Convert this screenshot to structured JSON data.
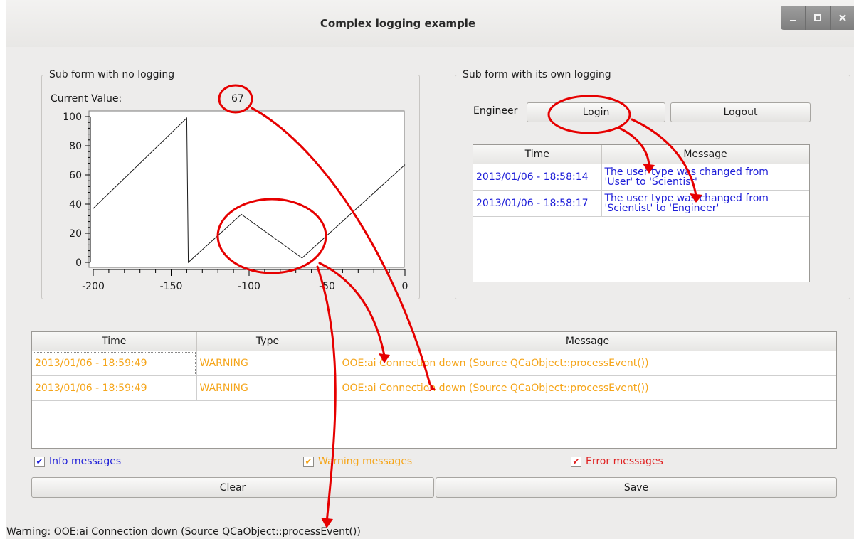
{
  "window": {
    "title": "Complex logging example"
  },
  "left_group": {
    "title": "Sub form with no logging",
    "current_value_label": "Current Value:",
    "current_value": "67"
  },
  "chart_data": {
    "type": "line",
    "x": [
      -200,
      -140,
      -139,
      -105,
      -66,
      0
    ],
    "series": [
      {
        "values": [
          37,
          99,
          0,
          33,
          3,
          67
        ]
      }
    ],
    "xlim": [
      -200,
      0
    ],
    "ylim": [
      0,
      100
    ],
    "xticks": [
      "-200",
      "-150",
      "-100",
      "-50",
      "0"
    ],
    "yticks": [
      "0",
      "20",
      "40",
      "60",
      "80",
      "100"
    ],
    "grid": false
  },
  "right_group": {
    "title": "Sub form with its own logging",
    "user_label": "Engineer",
    "login_label": "Login",
    "logout_label": "Logout",
    "columns": [
      "Time",
      "Message"
    ],
    "rows": [
      {
        "time": "2013/01/06 - 18:58:14",
        "message1": "The user type was changed from",
        "message2": "'User' to 'Scientist'"
      },
      {
        "time": "2013/01/06 - 18:58:17",
        "message1": "The user type was changed from",
        "message2": "'Scientist' to 'Engineer'"
      }
    ]
  },
  "main_log": {
    "columns": [
      "Time",
      "Type",
      "Message"
    ],
    "rows": [
      {
        "time": "2013/01/06 - 18:59:49",
        "type": "WARNING",
        "message": "OOE:ai Connection down (Source QCaObject::processEvent())"
      },
      {
        "time": "2013/01/06 - 18:59:49",
        "type": "WARNING",
        "message": "OOE:ai Connection down (Source QCaObject::processEvent())"
      }
    ]
  },
  "filters": {
    "info": "Info messages",
    "warning": "Warning messages",
    "error": "Error messages"
  },
  "buttons": {
    "clear": "Clear",
    "save": "Save"
  },
  "status_bar": {
    "text": "Warning: OOE:ai Connection down (Source QCaObject::processEvent())"
  },
  "colors": {
    "info": "#1e1ed8",
    "warning": "#f5a51a",
    "error": "#e02020",
    "annotation": "#e60000"
  }
}
